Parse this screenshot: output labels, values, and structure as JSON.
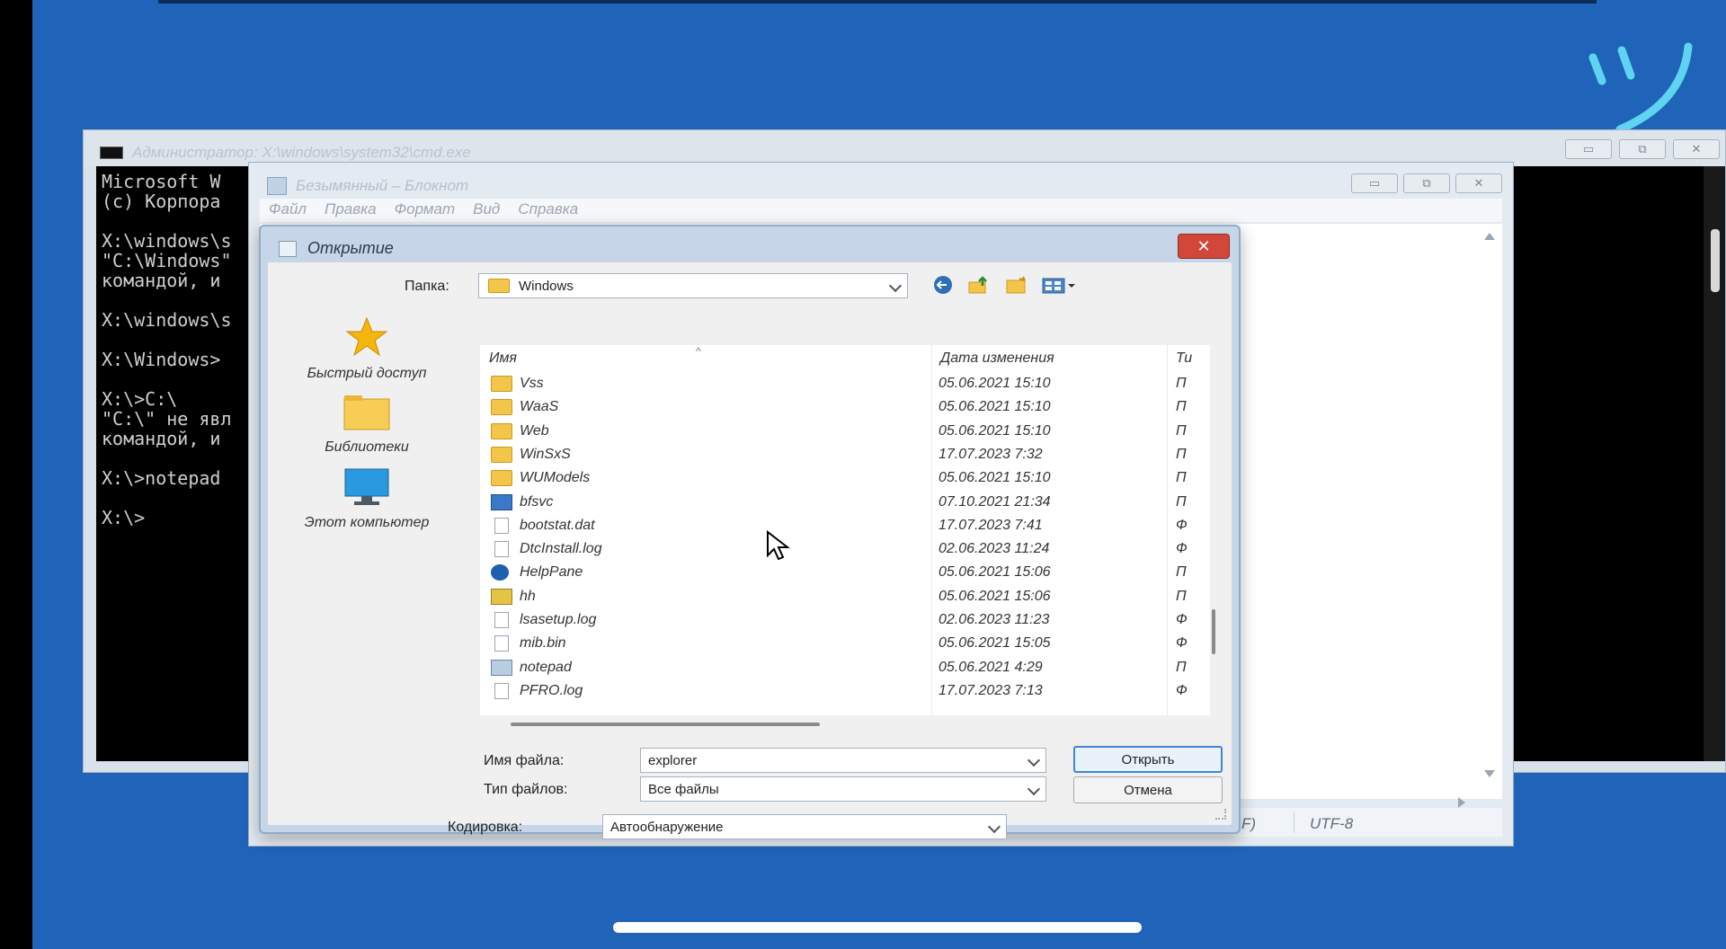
{
  "cmd": {
    "title": "Администратор: X:\\windows\\system32\\cmd.exe",
    "lines": [
      "Microsoft W",
      "(c) Корпора",
      "",
      "X:\\windows\\s",
      "\"C:\\Windows\"",
      "командой, и",
      "",
      "X:\\windows\\s",
      "",
      "X:\\Windows>",
      "",
      "X:\\>C:\\",
      "\"C:\\\" не явл",
      "командой, и",
      "",
      "X:\\>notepad",
      "",
      "X:\\>"
    ]
  },
  "notepad": {
    "title": "Безымянный – Блокнот",
    "menu": [
      "Файл",
      "Правка",
      "Формат",
      "Вид",
      "Справка"
    ],
    "status": [
      "F)",
      "UTF-8"
    ]
  },
  "dialog": {
    "title": "Открытие",
    "folder_label": "Папка:",
    "folder_value": "Windows",
    "places": [
      {
        "label": "Быстрый доступ",
        "icon": "star-icon"
      },
      {
        "label": "Библиотеки",
        "icon": "folder-icon"
      },
      {
        "label": "Этот компьютер",
        "icon": "computer-icon"
      }
    ],
    "columns": {
      "name": "Имя",
      "date": "Дата изменения",
      "type": "Ти"
    },
    "files": [
      {
        "name": "Vss",
        "date": "05.06.2021 15:10",
        "type": "П",
        "icon": "folder"
      },
      {
        "name": "WaaS",
        "date": "05.06.2021 15:10",
        "type": "П",
        "icon": "folder"
      },
      {
        "name": "Web",
        "date": "05.06.2021 15:10",
        "type": "П",
        "icon": "folder"
      },
      {
        "name": "WinSxS",
        "date": "17.07.2023 7:32",
        "type": "П",
        "icon": "folder"
      },
      {
        "name": "WUModels",
        "date": "05.06.2021 15:10",
        "type": "П",
        "icon": "folder"
      },
      {
        "name": "bfsvc",
        "date": "07.10.2021 21:34",
        "type": "П",
        "icon": "exe"
      },
      {
        "name": "bootstat.dat",
        "date": "17.07.2023 7:41",
        "type": "Ф",
        "icon": "file"
      },
      {
        "name": "DtcInstall.log",
        "date": "02.06.2023 11:24",
        "type": "Ф",
        "icon": "file"
      },
      {
        "name": "HelpPane",
        "date": "05.06.2021 15:06",
        "type": "П",
        "icon": "help"
      },
      {
        "name": "hh",
        "date": "05.06.2021 15:06",
        "type": "П",
        "icon": "hh"
      },
      {
        "name": "lsasetup.log",
        "date": "02.06.2023 11:23",
        "type": "Ф",
        "icon": "file"
      },
      {
        "name": "mib.bin",
        "date": "05.06.2021 15:05",
        "type": "Ф",
        "icon": "file"
      },
      {
        "name": "notepad",
        "date": "05.06.2021 4:29",
        "type": "П",
        "icon": "note"
      },
      {
        "name": "PFRO.log",
        "date": "17.07.2023 7:13",
        "type": "Ф",
        "icon": "file"
      }
    ],
    "filename_label": "Имя файла:",
    "filename_value": "explorer",
    "filetype_label": "Тип файлов:",
    "filetype_value": "Все файлы",
    "encoding_label": "Кодировка:",
    "encoding_value": "Автообнаружение",
    "open_button": "Открыть",
    "cancel_button": "Отмена"
  }
}
